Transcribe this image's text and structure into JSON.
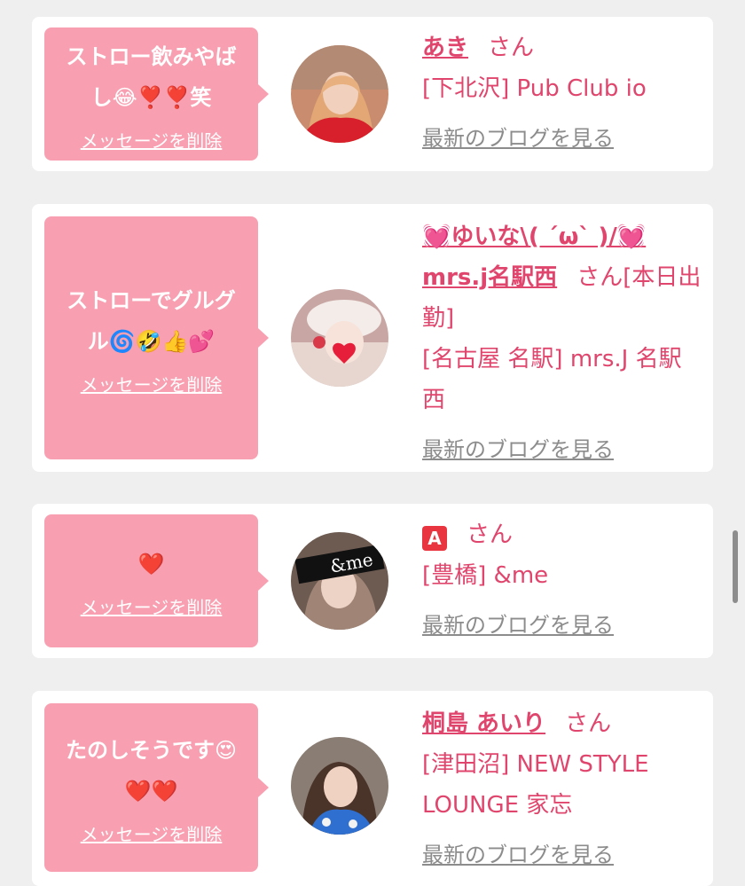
{
  "delete_label": "メッセージを削除",
  "blog_label": "最新のブログを見る",
  "san_label": "さん",
  "colors": {
    "page_bg": "#efefef",
    "bubble_bg": "#f8a0b1",
    "accent": "#e0466d",
    "muted": "#8c8c8c"
  },
  "entries": [
    {
      "message": "ストロー飲みやばし😂❣️❣️笑",
      "name": "あき",
      "name_suffix": "",
      "shop": "[下北沢] Pub Club io",
      "avatar_icon": "profile-photo-woman-red-sweater"
    },
    {
      "message": "ストローでグルグル🌀🤣👍💕",
      "name": "💓ゆいな\\( ´ω` )/💓mrs.j名駅西",
      "name_suffix": "[本日出勤]",
      "shop": "[名古屋 名駅] mrs.J 名駅西",
      "avatar_icon": "profile-photo-woman-white-cap"
    },
    {
      "message": "❤️",
      "name": "",
      "name_icon": "a-button-icon",
      "name_icon_text": "A",
      "name_suffix": "",
      "shop": "[豊橋] &me",
      "avatar_icon": "profile-photo-woman-with-logo",
      "avatar_text": "&me"
    },
    {
      "message": "たのしそうです😍❤️❤️",
      "name": "桐島 あいり",
      "name_suffix": "",
      "shop": "[津田沼] NEW STYLE LOUNGE 家忘",
      "avatar_icon": "profile-photo-woman-blue-dress"
    }
  ]
}
